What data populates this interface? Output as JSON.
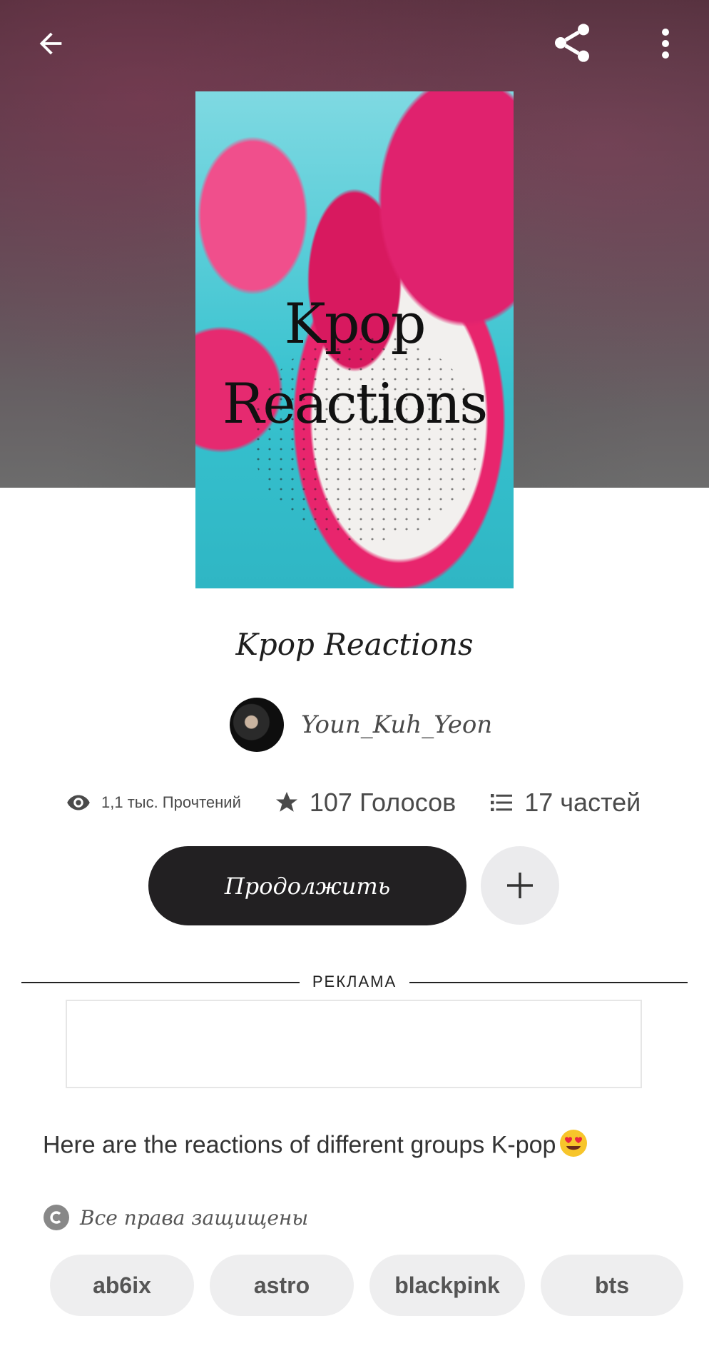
{
  "header": {
    "back_icon": "arrow-left-icon",
    "share_icon": "share-icon",
    "menu_icon": "more-vertical-icon"
  },
  "cover": {
    "title_line1": "Kpop",
    "title_line2": "Reactions"
  },
  "story": {
    "title": "Kpop Reactions",
    "author": "Youn_Kuh_Yeon"
  },
  "stats": {
    "reads": "1,1 тыс. Прочтений",
    "votes": "107 Голосов",
    "parts": "17 частей"
  },
  "actions": {
    "continue_label": "Продолжить",
    "add_icon": "plus-icon"
  },
  "ad": {
    "label": "РЕКЛАМА"
  },
  "description": "Here are the reactions of different groups K-pop",
  "copyright": "Все права защищены",
  "tags": [
    "ab6ix",
    "astro",
    "blackpink",
    "bts"
  ],
  "colors": {
    "primary_button": "#222022",
    "tag_background": "#eeeeef",
    "secondary_button": "#ebebed"
  }
}
